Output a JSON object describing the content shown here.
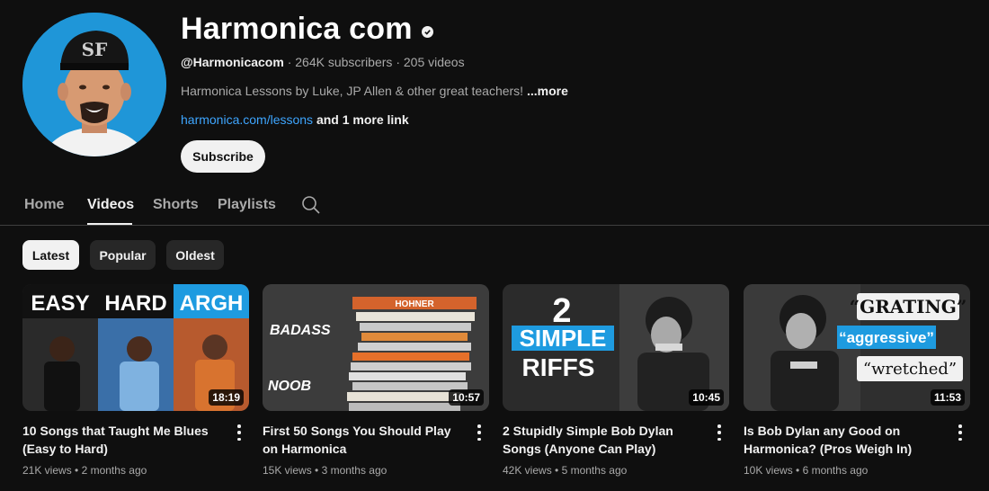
{
  "channel": {
    "name": "Harmonica com",
    "handle": "@Harmonicacom",
    "subscribers": "264K subscribers",
    "videos_count": "205 videos",
    "separator": "·",
    "description": "Harmonica Lessons by Luke, JP Allen & other great teachers!",
    "more_label": "...more",
    "link_text": "harmonica.com/lessons",
    "more_links": " and 1 more link",
    "subscribe_label": "Subscribe"
  },
  "tabs": [
    "Home",
    "Videos",
    "Shorts",
    "Playlists"
  ],
  "chips": [
    "Latest",
    "Popular",
    "Oldest"
  ],
  "videos": [
    {
      "title": "10 Songs that Taught Me Blues (Easy to Hard)",
      "views": "21K views",
      "age": "2 months ago",
      "duration": "18:19",
      "thumb_text": [
        "EASY",
        "HARD",
        "ARGH"
      ]
    },
    {
      "title": "First 50 Songs You Should Play on Harmonica",
      "views": "15K views",
      "age": "3 months ago",
      "duration": "10:57",
      "thumb_text": [
        "BADASS",
        "NOOB",
        "HOHNER"
      ]
    },
    {
      "title": "2 Stupidly Simple Bob Dylan Songs (Anyone Can Play)",
      "views": "42K views",
      "age": "5 months ago",
      "duration": "10:45",
      "thumb_text": [
        "2",
        "SIMPLE",
        "RIFFS"
      ]
    },
    {
      "title": "Is Bob Dylan any Good on Harmonica? (Pros Weigh In)",
      "views": "10K views",
      "age": "6 months ago",
      "duration": "11:53",
      "thumb_text": [
        "“GRATING”",
        "“aggressive”",
        "“wretched”"
      ]
    }
  ],
  "colors": {
    "background": "#0f0f0f",
    "link": "#3ea6ff",
    "chip": "#272727",
    "avatar_bg": "#1f96d8"
  }
}
